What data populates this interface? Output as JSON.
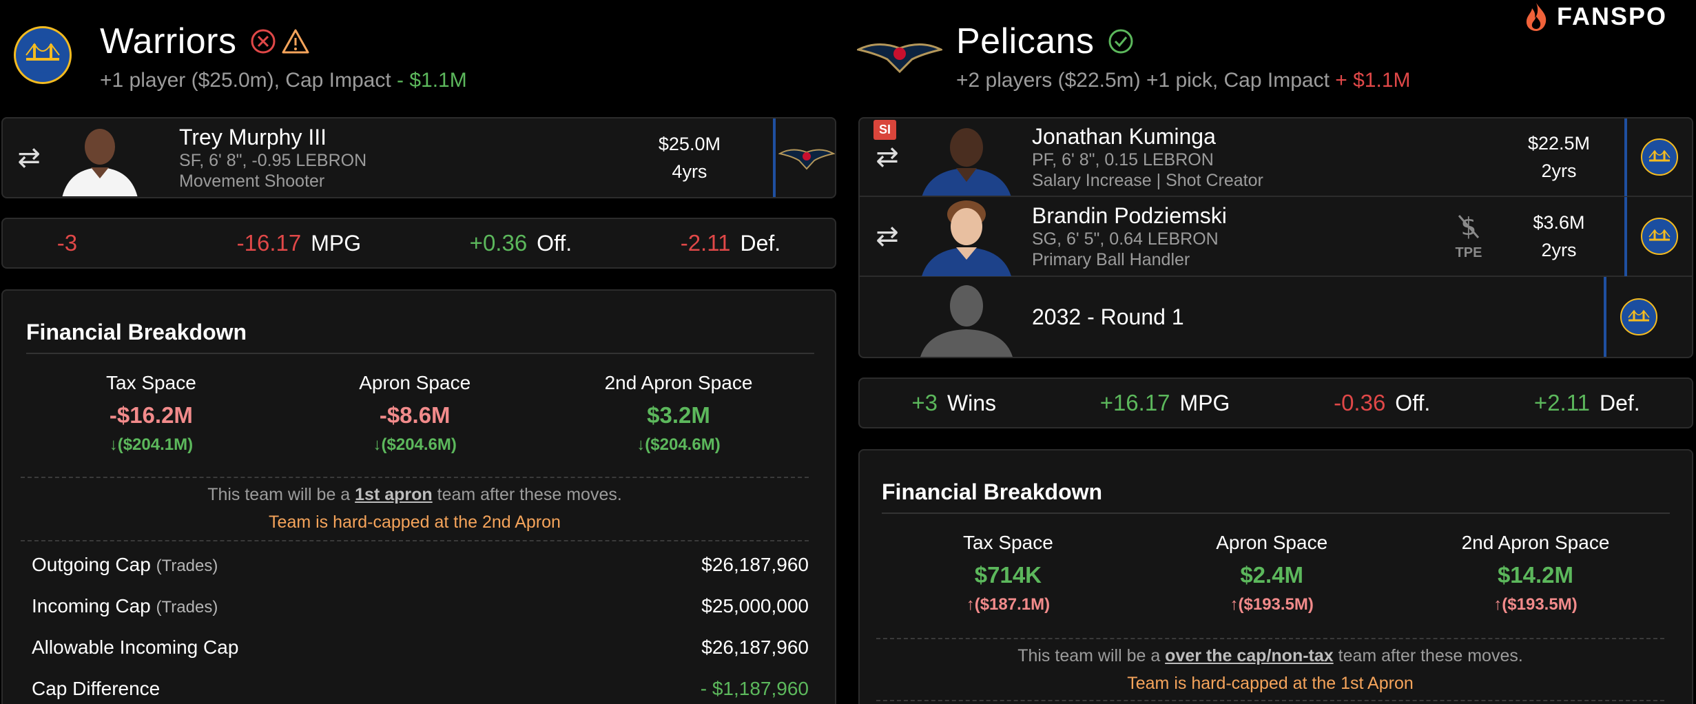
{
  "brand": {
    "name": "FANSPO"
  },
  "left_team": {
    "name": "Warriors",
    "subtitle_prefix": "+1 player ($25.0m), Cap Impact ",
    "subtitle_impact": "- $1.1M",
    "players": [
      {
        "name": "Trey Murphy III",
        "detail1": "SF, 6' 8\", -0.95 LEBRON",
        "detail2": "Movement Shooter",
        "salary": "$25.0M",
        "years": "4yrs"
      }
    ],
    "stats": {
      "wins_value": "-3",
      "mpg_value": "-16.17",
      "mpg_label": "MPG",
      "off_value": "+0.36",
      "off_label": "Off.",
      "def_value": "-2.11",
      "def_label": "Def."
    },
    "financial": {
      "title": "Financial Breakdown",
      "tax_label": "Tax Space",
      "tax_value": "-$16.2M",
      "tax_sub": "($204.1M)",
      "apron_label": "Apron Space",
      "apron_value": "-$8.6M",
      "apron_sub": "($204.6M)",
      "apron2_label": "2nd Apron Space",
      "apron2_value": "$3.2M",
      "apron2_sub": "($204.6M)",
      "note_prefix": "This team will be a ",
      "note_link": "1st apron",
      "note_suffix": " team after these moves.",
      "hardcap": "Team is hard-capped at the 2nd Apron",
      "rows": [
        {
          "label": "Outgoing Cap",
          "small": "(Trades)",
          "value": "$26,187,960"
        },
        {
          "label": "Incoming Cap",
          "small": "(Trades)",
          "value": "$25,000,000"
        },
        {
          "label": "Allowable Incoming Cap",
          "small": "",
          "value": "$26,187,960"
        },
        {
          "label": "Cap Difference",
          "small": "",
          "value": "- $1,187,960"
        }
      ]
    }
  },
  "right_team": {
    "name": "Pelicans",
    "subtitle_prefix": "+2 players ($22.5m) +1 pick, Cap Impact ",
    "subtitle_impact": "+ $1.1M",
    "players": [
      {
        "badge": "SI",
        "name": "Jonathan Kuminga",
        "detail1": "PF, 6' 8\", 0.15 LEBRON",
        "detail2": "Salary Increase | Shot Creator",
        "salary": "$22.5M",
        "years": "2yrs"
      },
      {
        "name": "Brandin Podziemski",
        "detail1": "SG, 6' 5\", 0.64 LEBRON",
        "detail2": "Primary Ball Handler",
        "tpe": "TPE",
        "salary": "$3.6M",
        "years": "2yrs"
      }
    ],
    "pick": {
      "label": "2032 - Round 1"
    },
    "stats": {
      "wins_value": "+3",
      "wins_label": "Wins",
      "mpg_value": "+16.17",
      "mpg_label": "MPG",
      "off_value": "-0.36",
      "off_label": "Off.",
      "def_value": "+2.11",
      "def_label": "Def."
    },
    "financial": {
      "title": "Financial Breakdown",
      "tax_label": "Tax Space",
      "tax_value": "$714K",
      "tax_sub": "($187.1M)",
      "apron_label": "Apron Space",
      "apron_value": "$2.4M",
      "apron_sub": "($193.5M)",
      "apron2_label": "2nd Apron Space",
      "apron2_value": "$14.2M",
      "apron2_sub": "($193.5M)",
      "note_prefix": "This team will be a ",
      "note_link": "over the cap/non-tax",
      "note_suffix": " team after these moves.",
      "hardcap": "Team is hard-capped at the 1st Apron"
    }
  },
  "colors": {
    "positive": "#5cb85c",
    "negative": "#e04848",
    "warning": "#f5a45b",
    "accent_blue": "#1f4fa0",
    "gold": "#f4bb20"
  }
}
